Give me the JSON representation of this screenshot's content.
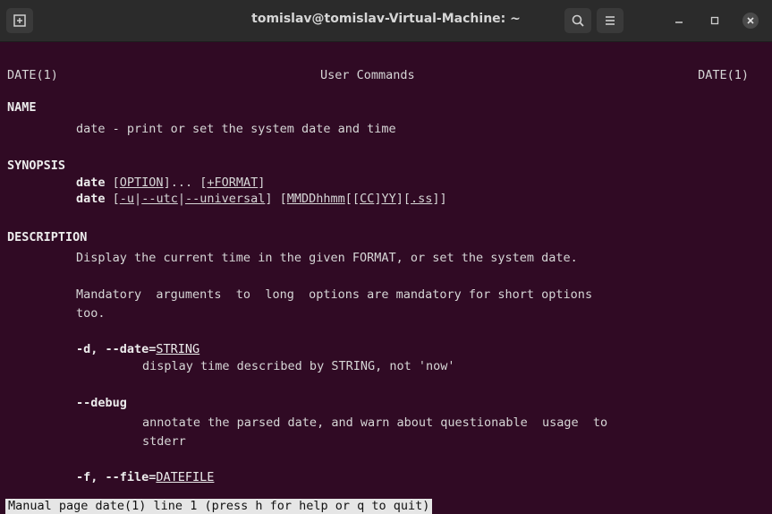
{
  "window": {
    "title": "tomislav@tomislav-Virtual-Machine: ~"
  },
  "header": {
    "left": "DATE(1)",
    "center": "User Commands",
    "right": "DATE(1)"
  },
  "sections": {
    "name_heading": "NAME",
    "name_text": "date - print or set the system date and time",
    "synopsis_heading": "SYNOPSIS",
    "synopsis_cmd": "date",
    "synopsis_line1_a": "OPTION",
    "synopsis_line1_b": "]... [",
    "synopsis_line1_c": "+FORMAT",
    "synopsis_line2_a": "-u",
    "synopsis_line2_b": "--utc",
    "synopsis_line2_c": "--universal",
    "synopsis_line2_d": "MMDDhhmm",
    "synopsis_line2_e": "CC",
    "synopsis_line2_f": "YY",
    "synopsis_line2_g": ".ss",
    "description_heading": "DESCRIPTION",
    "description_line1": "Display the current time in the given FORMAT, or set the system date.",
    "mandatory_line1": "Mandatory  arguments  to  long  options are mandatory for short options",
    "mandatory_line2": "too.",
    "opt_date_flag": "-d, --date=",
    "opt_date_arg": "STRING",
    "opt_date_desc": "display time described by STRING, not 'now'",
    "opt_debug_flag": "--debug",
    "opt_debug_desc1": "annotate the parsed date, and warn about questionable  usage  to",
    "opt_debug_desc2": "stderr",
    "opt_file_flag": "-f, --file=",
    "opt_file_arg": "DATEFILE"
  },
  "status": {
    "text": "Manual page date(1) line 1 (press h for help or q to quit)"
  },
  "colors": {
    "background": "#300a24",
    "titlebar": "#2b2b2b",
    "text": "#d6d6d6"
  },
  "icons": [
    "new-tab-icon",
    "search-icon",
    "hamburger-menu-icon",
    "minimize-icon",
    "maximize-icon",
    "close-icon"
  ]
}
